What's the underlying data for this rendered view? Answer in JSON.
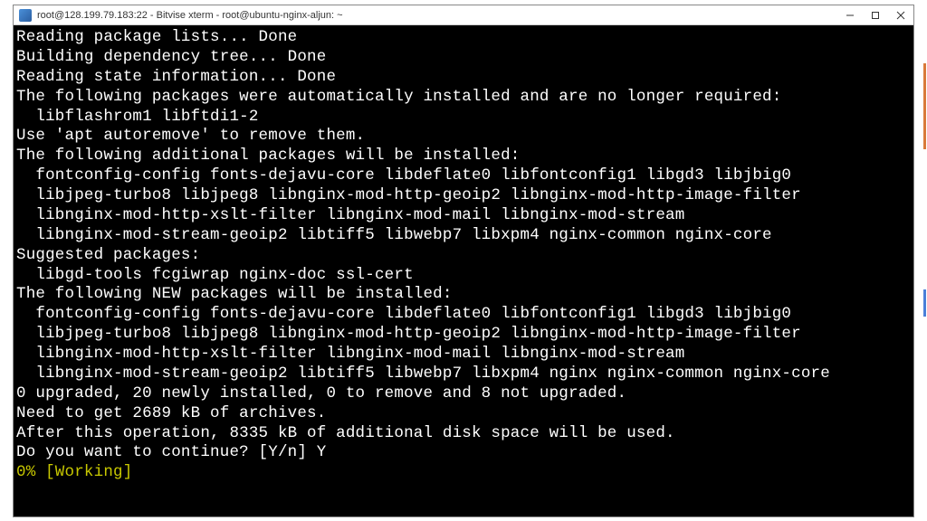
{
  "window": {
    "title": "root@128.199.79.183:22 - Bitvise xterm - root@ubuntu-nginx-aljun: ~",
    "icon_label": "B"
  },
  "terminal": {
    "lines": [
      "Reading package lists... Done",
      "Building dependency tree... Done",
      "Reading state information... Done",
      "The following packages were automatically installed and are no longer required:",
      "  libflashrom1 libftdi1-2",
      "Use 'apt autoremove' to remove them.",
      "The following additional packages will be installed:",
      "  fontconfig-config fonts-dejavu-core libdeflate0 libfontconfig1 libgd3 libjbig0",
      "  libjpeg-turbo8 libjpeg8 libnginx-mod-http-geoip2 libnginx-mod-http-image-filter",
      "  libnginx-mod-http-xslt-filter libnginx-mod-mail libnginx-mod-stream",
      "  libnginx-mod-stream-geoip2 libtiff5 libwebp7 libxpm4 nginx-common nginx-core",
      "Suggested packages:",
      "  libgd-tools fcgiwrap nginx-doc ssl-cert",
      "The following NEW packages will be installed:",
      "  fontconfig-config fonts-dejavu-core libdeflate0 libfontconfig1 libgd3 libjbig0",
      "  libjpeg-turbo8 libjpeg8 libnginx-mod-http-geoip2 libnginx-mod-http-image-filter",
      "  libnginx-mod-http-xslt-filter libnginx-mod-mail libnginx-mod-stream",
      "  libnginx-mod-stream-geoip2 libtiff5 libwebp7 libxpm4 nginx nginx-common nginx-core",
      "0 upgraded, 20 newly installed, 0 to remove and 8 not upgraded.",
      "Need to get 2689 kB of archives.",
      "After this operation, 8335 kB of additional disk space will be used.",
      "Do you want to continue? [Y/n] Y"
    ],
    "progress": "0% [Working]"
  }
}
